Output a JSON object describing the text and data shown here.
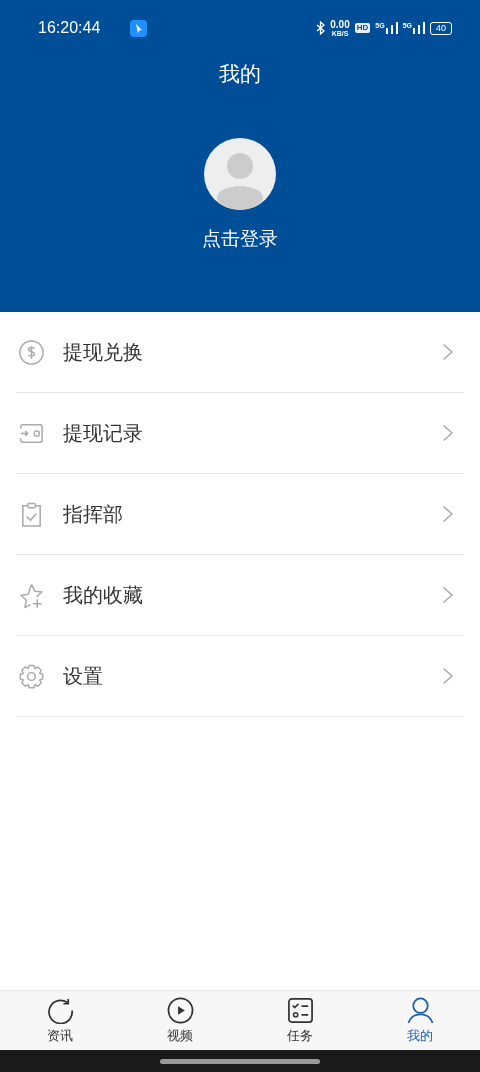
{
  "status_bar": {
    "time": "16:20:44",
    "speed_value": "0.00",
    "speed_unit": "KB/S",
    "hd_label": "HD",
    "sim_1": "5G",
    "sim_2": "5G",
    "battery": "40"
  },
  "header": {
    "title": "我的",
    "login_label": "点击登录"
  },
  "menu": [
    {
      "label": "提现兑换"
    },
    {
      "label": "提现记录"
    },
    {
      "label": "指挥部"
    },
    {
      "label": "我的收藏"
    },
    {
      "label": "设置"
    }
  ],
  "tab_bar": [
    {
      "label": "资讯",
      "selected": false
    },
    {
      "label": "视频",
      "selected": false
    },
    {
      "label": "任务",
      "selected": false
    },
    {
      "label": "我的",
      "selected": true
    }
  ]
}
